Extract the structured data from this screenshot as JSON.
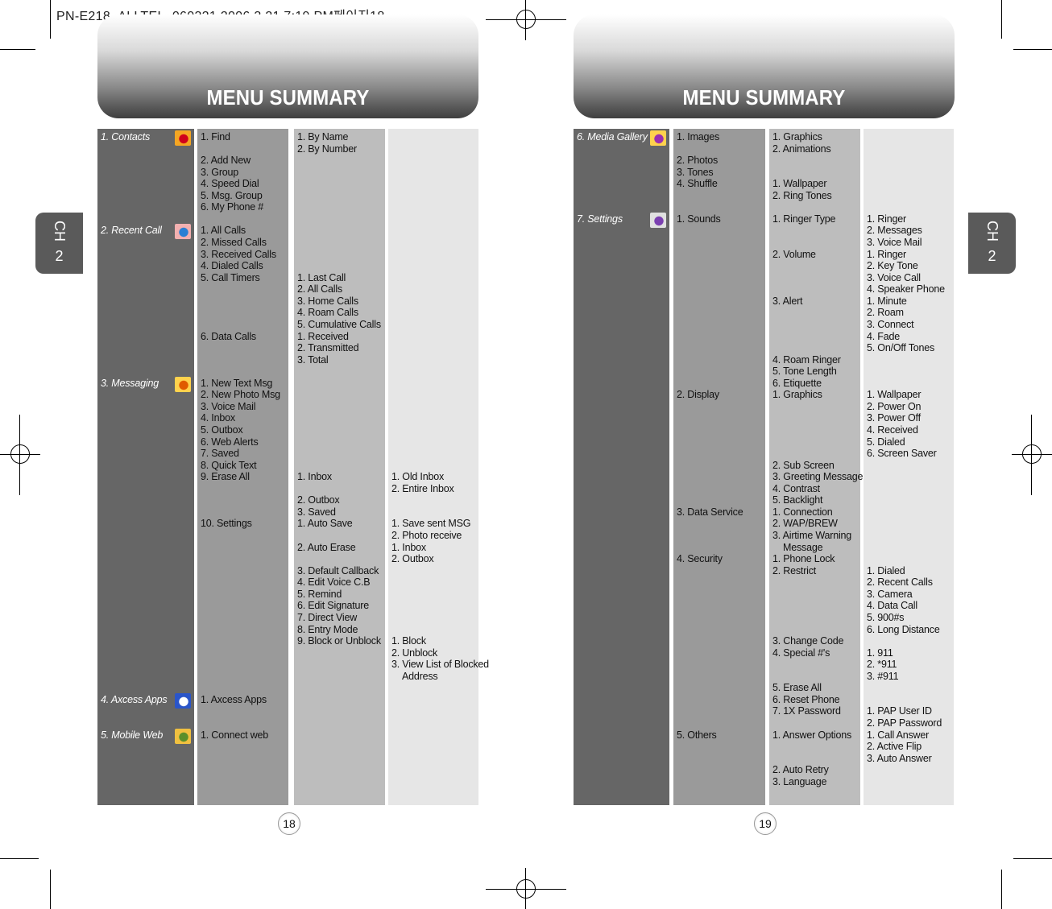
{
  "slug": "PN-E218_ALLTEL_060321  2006.3.21 7:19 PM페이지18",
  "pages": [
    {
      "title": "MENU SUMMARY",
      "page_number": "18",
      "chapter_tab": {
        "label": "CH",
        "number": "2"
      },
      "columns": [
        [
          "1. Contacts",
          "2. Recent Call",
          "3. Messaging",
          "4. Axcess Apps",
          "5. Mobile Web"
        ],
        [
          "1. Find",
          "2. Add New",
          "3. Group",
          "4. Speed Dial",
          "5. Msg. Group",
          "6. My Phone #",
          "1. All Calls",
          "2. Missed Calls",
          "3. Received Calls",
          "4. Dialed Calls",
          "5. Call Timers",
          "6. Data Calls",
          "1. New Text Msg",
          "2. New Photo Msg",
          "3. Voice Mail",
          "4. Inbox",
          "5. Outbox",
          "6. Web Alerts",
          "7. Saved",
          "8. Quick Text",
          "9. Erase All",
          "10. Settings",
          "1. Axcess Apps",
          "1. Connect web"
        ],
        [
          "1. By Name",
          "2. By Number",
          "1. Last Call",
          "2. All Calls",
          "3. Home Calls",
          "4. Roam Calls",
          "5. Cumulative Calls",
          "1. Received",
          "2. Transmitted",
          "3. Total",
          "1. Inbox",
          "2. Outbox",
          "3. Saved",
          "1. Auto Save",
          "2. Auto Erase",
          "3. Default Callback",
          "4. Edit Voice C.B",
          "5. Remind",
          "6. Edit Signature",
          "7. Direct View",
          "8. Entry Mode",
          "9. Block or Unblock"
        ],
        [
          "1. Old Inbox",
          "2. Entire Inbox",
          "1. Save sent MSG",
          "2. Photo receive",
          "1. Inbox",
          "2. Outbox",
          "1. Block",
          "2. Unblock",
          "3. View List of Blocked",
          "Address"
        ]
      ],
      "icons": [
        "contacts-book-icon",
        "recent-call-icon",
        "messaging-icon",
        "axcess-apps-icon",
        "mobile-web-icon"
      ]
    },
    {
      "title": "MENU SUMMARY",
      "page_number": "19",
      "chapter_tab": {
        "label": "CH",
        "number": "2"
      },
      "columns": [
        [
          "6. Media Gallery",
          "7. Settings"
        ],
        [
          "1. Images",
          "2. Photos",
          "3. Tones",
          "4. Shuffle",
          "1. Sounds",
          "2. Display",
          "3. Data Service",
          "4. Security",
          "5. Others"
        ],
        [
          "1. Graphics",
          "2. Animations",
          "1. Wallpaper",
          "2. Ring Tones",
          "1. Ringer Type",
          "2. Volume",
          "3. Alert",
          "4. Roam Ringer",
          "5. Tone Length",
          "6. Etiquette",
          "1. Graphics",
          "2. Sub Screen",
          "3. Greeting Message",
          "4. Contrast",
          "5. Backlight",
          "1. Connection",
          "2. WAP/BREW",
          "3. Airtime Warning",
          "Message",
          "1. Phone Lock",
          "2. Restrict",
          "3. Change Code",
          "4. Special #'s",
          "5. Erase All",
          "6. Reset Phone",
          "7. 1X Password",
          "1. Answer Options",
          "2. Auto Retry",
          "3. Language"
        ],
        [
          "1. Ringer",
          "2. Messages",
          "3. Voice Mail",
          "1. Ringer",
          "2. Key Tone",
          "3. Voice Call",
          "4. Speaker Phone",
          "1. Minute",
          "2. Roam",
          "3. Connect",
          "4. Fade",
          "5. On/Off Tones",
          "1. Wallpaper",
          "2. Power On",
          "3. Power Off",
          "4. Received",
          "5. Dialed",
          "6. Screen Saver",
          "1. Dialed",
          "2. Recent Calls",
          "3. Camera",
          "4. Data Call",
          "5. 900#s",
          "6. Long Distance",
          "1. 911",
          "2. *911",
          "3. #911",
          "1. PAP User ID",
          "2. PAP Password",
          "1. Call Answer",
          "2. Active Flip",
          "3. Auto Answer"
        ]
      ],
      "icons": [
        "media-gallery-icon",
        "settings-icon"
      ]
    }
  ],
  "colors": {
    "col1": "#666666",
    "col2": "#9a9a9a",
    "col3": "#bdbdbd",
    "col4": "#e6e6e6",
    "tab": "#5a5a5a"
  }
}
